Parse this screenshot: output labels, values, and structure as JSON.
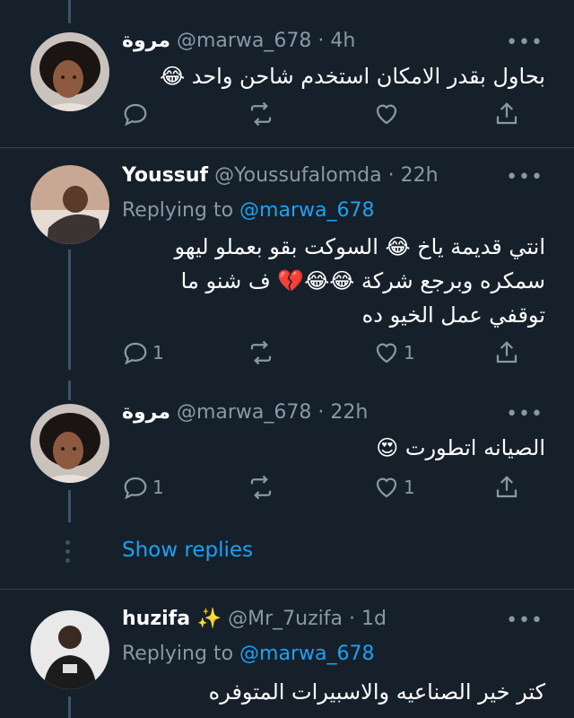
{
  "tweets": [
    {
      "name": "مروة",
      "handle": "@marwa_678",
      "time": "4h",
      "body_lines": [
        "بحاول بقدر الامكان استخدم شاحن واحد 😂"
      ],
      "reply_count": "",
      "like_count": ""
    },
    {
      "name": "Youssuf",
      "handle": "@Youssufalomda",
      "time": "22h",
      "replying_label": "Replying to",
      "replying_mention": "@marwa_678",
      "body_lines": [
        "انتي قديمة ياخ 😂 السوكت بقو بعملو ليهو",
        "سمكره وبرجع شركة 😂😂💔 ف شنو ما",
        "توقفي عمل الخيو ده"
      ],
      "reply_count": "1",
      "like_count": "1"
    },
    {
      "name": "مروة",
      "handle": "@marwa_678",
      "time": "22h",
      "body_lines": [
        "الصيانه اتطورت 😍"
      ],
      "reply_count": "1",
      "like_count": "1"
    },
    {
      "name": "huzifa ✨",
      "handle": "@Mr_7uzifa",
      "time": "1d",
      "replying_label": "Replying to",
      "replying_mention": "@marwa_678",
      "body_lines": [
        "كتر خير الصناعيه والاسبيرات المتوفره"
      ]
    }
  ],
  "show_replies_label": "Show replies",
  "more_glyph": "•••",
  "separator": "·",
  "colors": {
    "background": "#15202b",
    "text": "#ffffff",
    "muted": "#8899a6",
    "accent": "#1da1f2",
    "divider": "#38444d",
    "thread_line": "#3d5466"
  },
  "icons": {
    "reply": "reply-icon",
    "retweet": "retweet-icon",
    "like": "like-icon",
    "share": "share-icon",
    "more": "more-icon"
  }
}
